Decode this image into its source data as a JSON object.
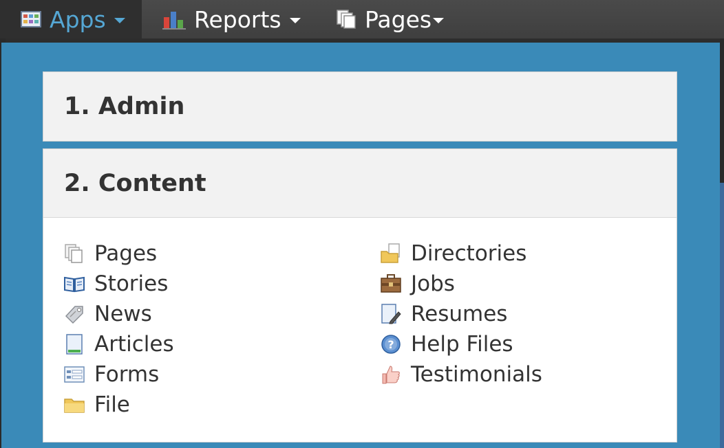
{
  "nav": [
    {
      "label": "Apps",
      "icon": "apps-grid-icon",
      "active": true
    },
    {
      "label": "Reports",
      "icon": "bar-chart-icon",
      "active": false
    },
    {
      "label": "Pages",
      "icon": "pages-icon",
      "active": false
    }
  ],
  "sections": [
    {
      "title": "1. Admin"
    },
    {
      "title": "2. Content"
    }
  ],
  "content_items": {
    "col1": [
      {
        "label": "Pages",
        "icon": "pages-icon"
      },
      {
        "label": "Stories",
        "icon": "open-book-icon"
      },
      {
        "label": "News",
        "icon": "tag-icon"
      },
      {
        "label": "Articles",
        "icon": "document-icon"
      },
      {
        "label": "Forms",
        "icon": "form-icon"
      },
      {
        "label": "File",
        "icon": "folder-icon"
      }
    ],
    "col2": [
      {
        "label": "Directories",
        "icon": "folder-document-icon"
      },
      {
        "label": "Jobs",
        "icon": "briefcase-icon"
      },
      {
        "label": "Resumes",
        "icon": "document-edit-icon"
      },
      {
        "label": "Help Files",
        "icon": "help-icon"
      },
      {
        "label": "Testimonials",
        "icon": "thumbs-up-icon"
      }
    ]
  },
  "colors": {
    "panel": "#3a8ab8",
    "active_nav_text": "#55a7d4",
    "nav_bg": "#444444"
  }
}
